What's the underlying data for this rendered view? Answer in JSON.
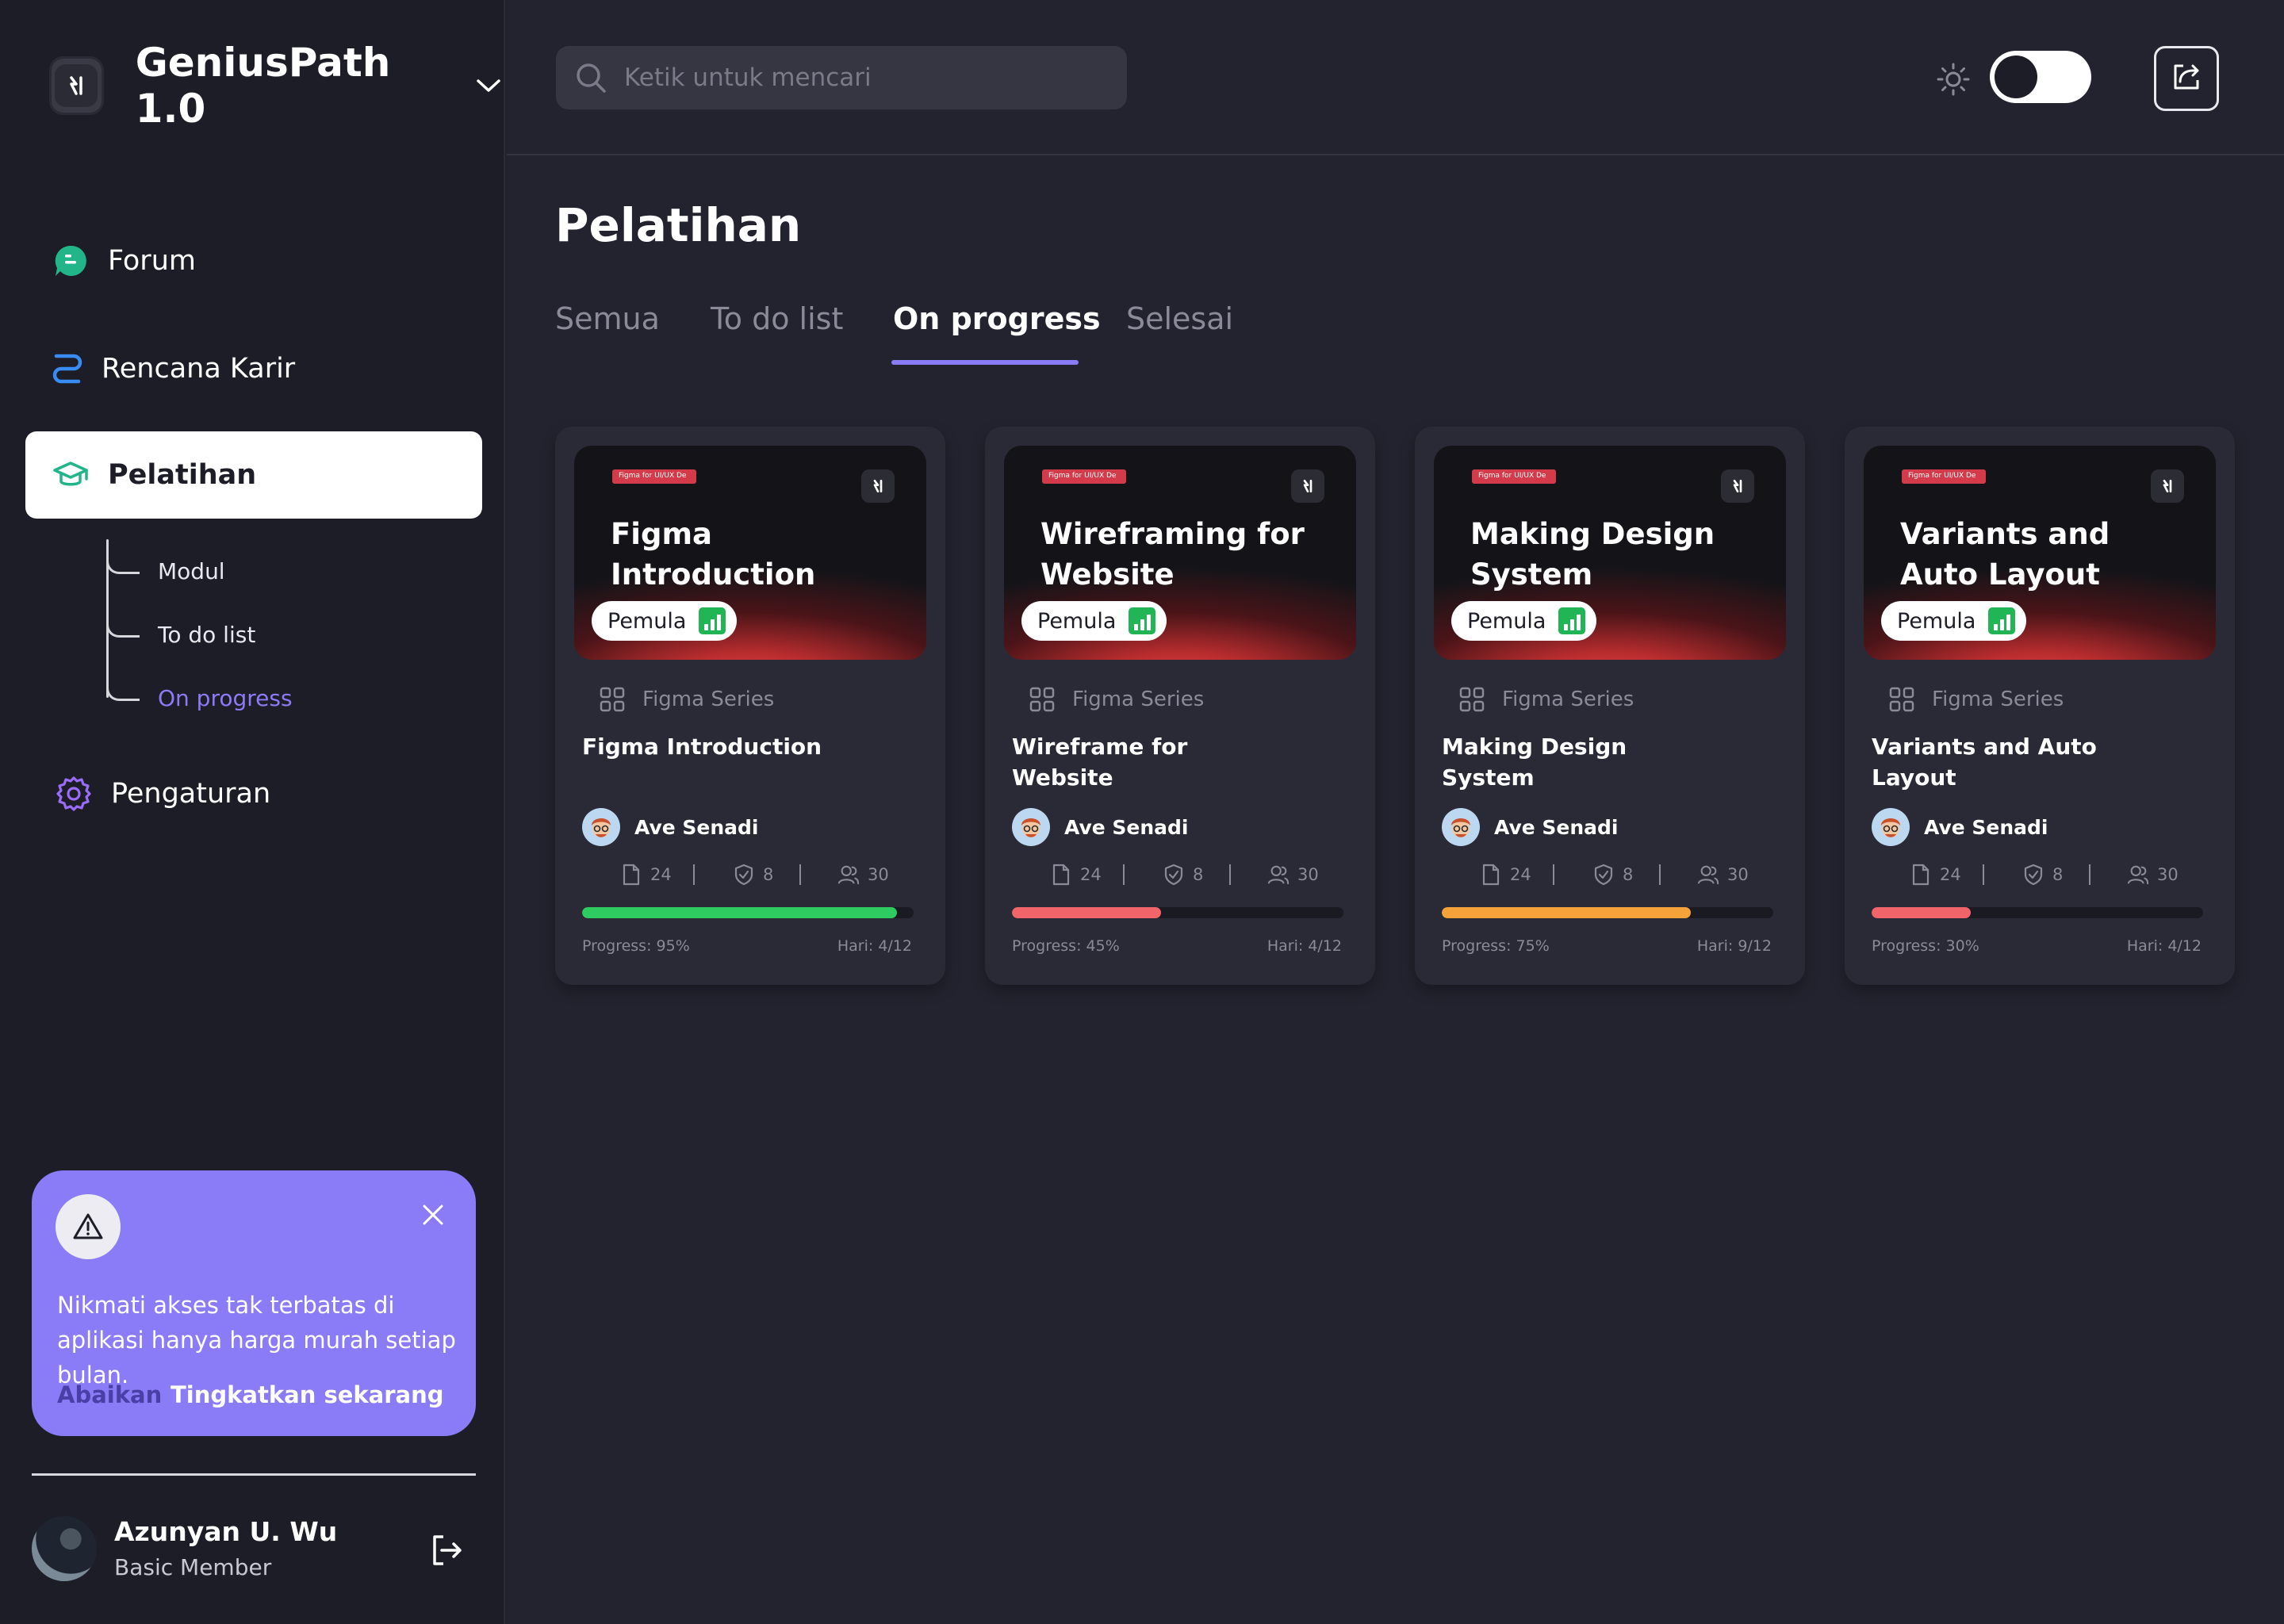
{
  "app": {
    "name": "GeniusPath 1.0"
  },
  "sidebar": {
    "items": [
      {
        "label": "Forum",
        "icon": "forum-icon"
      },
      {
        "label": "Rencana Karir",
        "icon": "route-icon"
      },
      {
        "label": "Pelatihan",
        "icon": "graduation-cap-icon",
        "active": true
      },
      {
        "label": "Pengaturan",
        "icon": "gear-icon"
      }
    ],
    "sub_items": [
      {
        "label": "Modul"
      },
      {
        "label": "To do list"
      },
      {
        "label": "On progress",
        "active": true
      }
    ]
  },
  "promo": {
    "message": "Nikmati akses tak terbatas di aplikasi hanya harga murah setiap bulan.",
    "dismiss": "Abaikan",
    "upgrade": "Tingkatkan sekarang"
  },
  "user": {
    "name": "Azunyan U. Wu",
    "role": "Basic Member"
  },
  "search": {
    "placeholder": "Ketik untuk mencari"
  },
  "theme_toggle": {
    "state": "dark"
  },
  "page": {
    "title": "Pelatihan",
    "tabs": [
      {
        "label": "Semua"
      },
      {
        "label": "To do list"
      },
      {
        "label": "On progress",
        "active": true
      },
      {
        "label": "Selesai"
      }
    ]
  },
  "colors": {
    "accent": "#8a7bf7",
    "progress_green": "#2ecc60",
    "progress_red": "#f0646a",
    "progress_orange": "#f5a23a"
  },
  "courses": [
    {
      "thumb_tag": "Figma for UI/UX Design",
      "thumb_title": "Figma Introduction",
      "level": "Pemula",
      "series": "Figma Series",
      "title": "Figma Introduction",
      "author": "Ave Senadi",
      "files": "24",
      "quizzes": "8",
      "learners": "30",
      "progress_value": 95,
      "progress_text": "Progress: 95%",
      "days": "Hari: 4/12",
      "progress_color": "#2ecc60"
    },
    {
      "thumb_tag": "Figma for UI/UX Design",
      "thumb_title": "Wireframing for Website",
      "level": "Pemula",
      "series": "Figma Series",
      "title": "Wireframe for Website",
      "author": "Ave Senadi",
      "files": "24",
      "quizzes": "8",
      "learners": "30",
      "progress_value": 45,
      "progress_text": "Progress: 45%",
      "days": "Hari: 4/12",
      "progress_color": "#f0646a"
    },
    {
      "thumb_tag": "Figma for UI/UX Design",
      "thumb_title": "Making Design System",
      "level": "Pemula",
      "series": "Figma Series",
      "title": "Making Design System",
      "author": "Ave Senadi",
      "files": "24",
      "quizzes": "8",
      "learners": "30",
      "progress_value": 75,
      "progress_text": "Progress: 75%",
      "days": "Hari: 9/12",
      "progress_color": "#f5a23a"
    },
    {
      "thumb_tag": "Figma for UI/UX Design",
      "thumb_title": "Variants and Auto Layout",
      "level": "Pemula",
      "series": "Figma Series",
      "title": "Variants and Auto Layout",
      "author": "Ave Senadi",
      "files": "24",
      "quizzes": "8",
      "learners": "30",
      "progress_value": 30,
      "progress_text": "Progress: 30%",
      "days": "Hari: 4/12",
      "progress_color": "#f0646a"
    }
  ]
}
